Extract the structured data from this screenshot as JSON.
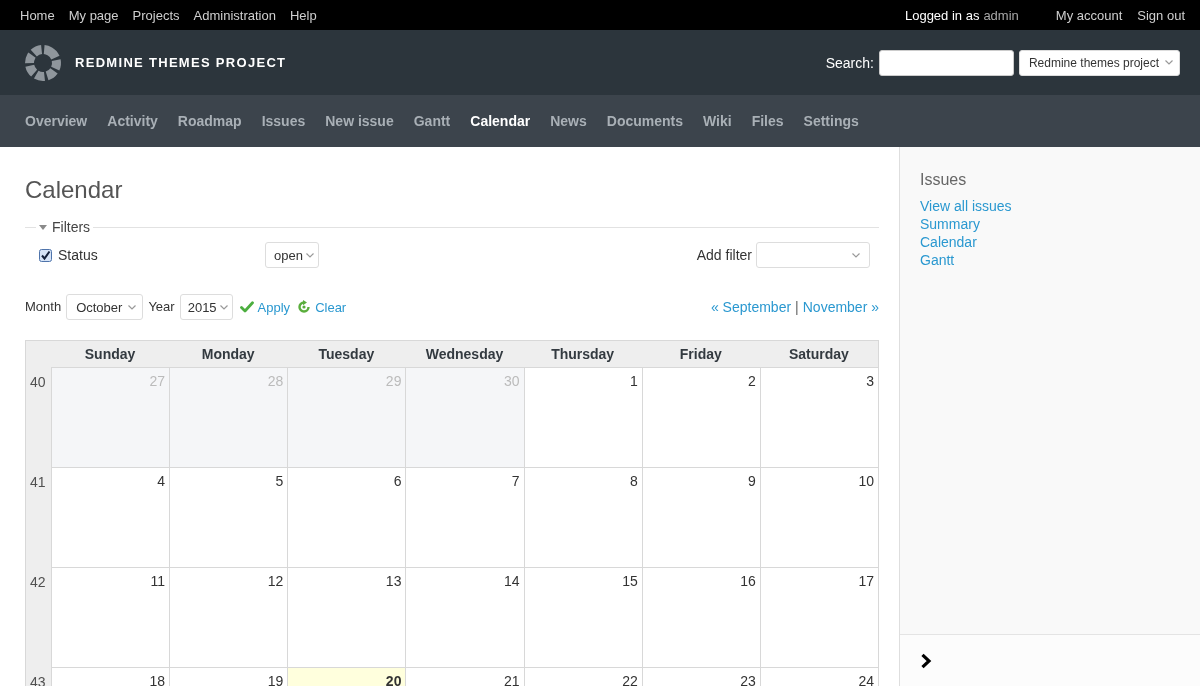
{
  "top_menu": {
    "links": [
      "Home",
      "My page",
      "Projects",
      "Administration",
      "Help"
    ],
    "logged_in": {
      "label": "Logged in as",
      "user": "admin"
    },
    "account_links": [
      "My account",
      "Sign out"
    ]
  },
  "header": {
    "title": "REDMINE THEMES PROJECT",
    "search_label": "Search:",
    "project_jump": "Redmine themes project"
  },
  "main_menu": [
    {
      "label": "Overview",
      "selected": false
    },
    {
      "label": "Activity",
      "selected": false
    },
    {
      "label": "Roadmap",
      "selected": false
    },
    {
      "label": "Issues",
      "selected": false
    },
    {
      "label": "New issue",
      "selected": false
    },
    {
      "label": "Gantt",
      "selected": false
    },
    {
      "label": "Calendar",
      "selected": true
    },
    {
      "label": "News",
      "selected": false
    },
    {
      "label": "Documents",
      "selected": false
    },
    {
      "label": "Wiki",
      "selected": false
    },
    {
      "label": "Files",
      "selected": false
    },
    {
      "label": "Settings",
      "selected": false
    }
  ],
  "page_title": "Calendar",
  "filters": {
    "legend": "Filters",
    "expanded": true,
    "rows": [
      {
        "label": "Status",
        "checked": true,
        "operator": "open"
      }
    ],
    "add_filter_label": "Add filter"
  },
  "period": {
    "month_label": "Month",
    "month": "October",
    "year_label": "Year",
    "year": "2015",
    "apply": "Apply",
    "clear": "Clear",
    "previous": "« September",
    "separator": "|",
    "next": "November »"
  },
  "calendar": {
    "day_names": [
      "Sunday",
      "Monday",
      "Tuesday",
      "Wednesday",
      "Thursday",
      "Friday",
      "Saturday"
    ],
    "weeks": [
      {
        "number": "40",
        "days": [
          {
            "day": "27",
            "other_month": true,
            "today": false
          },
          {
            "day": "28",
            "other_month": true,
            "today": false
          },
          {
            "day": "29",
            "other_month": true,
            "today": false
          },
          {
            "day": "30",
            "other_month": true,
            "today": false
          },
          {
            "day": "1",
            "other_month": false,
            "today": false
          },
          {
            "day": "2",
            "other_month": false,
            "today": false
          },
          {
            "day": "3",
            "other_month": false,
            "today": false
          }
        ]
      },
      {
        "number": "41",
        "days": [
          {
            "day": "4",
            "other_month": false,
            "today": false
          },
          {
            "day": "5",
            "other_month": false,
            "today": false
          },
          {
            "day": "6",
            "other_month": false,
            "today": false
          },
          {
            "day": "7",
            "other_month": false,
            "today": false
          },
          {
            "day": "8",
            "other_month": false,
            "today": false
          },
          {
            "day": "9",
            "other_month": false,
            "today": false
          },
          {
            "day": "10",
            "other_month": false,
            "today": false
          }
        ]
      },
      {
        "number": "42",
        "days": [
          {
            "day": "11",
            "other_month": false,
            "today": false
          },
          {
            "day": "12",
            "other_month": false,
            "today": false
          },
          {
            "day": "13",
            "other_month": false,
            "today": false
          },
          {
            "day": "14",
            "other_month": false,
            "today": false
          },
          {
            "day": "15",
            "other_month": false,
            "today": false
          },
          {
            "day": "16",
            "other_month": false,
            "today": false
          },
          {
            "day": "17",
            "other_month": false,
            "today": false
          }
        ]
      },
      {
        "number": "43",
        "days": [
          {
            "day": "18",
            "other_month": false,
            "today": false
          },
          {
            "day": "19",
            "other_month": false,
            "today": false
          },
          {
            "day": "20",
            "other_month": false,
            "today": true
          },
          {
            "day": "21",
            "other_month": false,
            "today": false
          },
          {
            "day": "22",
            "other_month": false,
            "today": false
          },
          {
            "day": "23",
            "other_month": false,
            "today": false
          },
          {
            "day": "24",
            "other_month": false,
            "today": false
          }
        ]
      }
    ]
  },
  "sidebar": {
    "title": "Issues",
    "links": [
      "View all issues",
      "Summary",
      "Calendar",
      "Gantt"
    ]
  }
}
